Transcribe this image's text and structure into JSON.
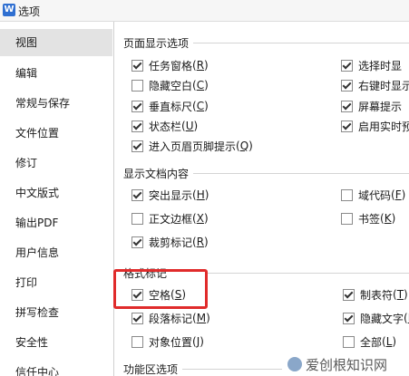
{
  "window": {
    "app_icon": "W",
    "title": "选项"
  },
  "sidebar": {
    "items": [
      {
        "label": "视图",
        "selected": true
      },
      {
        "label": "编辑"
      },
      {
        "label": "常规与保存"
      },
      {
        "label": "文件位置"
      },
      {
        "label": "修订"
      },
      {
        "label": "中文版式"
      },
      {
        "label": "输出PDF"
      },
      {
        "label": "用户信息"
      },
      {
        "label": "打印"
      },
      {
        "label": "拼写检查"
      },
      {
        "label": "安全性"
      },
      {
        "label": "信任中心"
      }
    ]
  },
  "sections": {
    "page_display": {
      "title": "页面显示选项",
      "options": [
        {
          "label": "任务窗格",
          "key": "R",
          "checked": true
        },
        {
          "label": "隐藏空白",
          "key": "C",
          "checked": false
        },
        {
          "label": "垂直标尺",
          "key": "C",
          "checked": true
        },
        {
          "label": "状态栏",
          "key": "U",
          "checked": true
        },
        {
          "label": "进入页眉页脚提示",
          "key": "Q",
          "checked": true
        },
        {
          "label": "选择时显",
          "key": "",
          "checked": true
        },
        {
          "label": "右键时显示",
          "key": "",
          "checked": true
        },
        {
          "label": "屏幕提示",
          "key": "",
          "checked": true
        },
        {
          "label": "启用实时预",
          "key": "",
          "checked": true
        }
      ]
    },
    "doc_content": {
      "title": "显示文档内容",
      "options": [
        {
          "label": "突出显示",
          "key": "H",
          "checked": true
        },
        {
          "label": "正文边框",
          "key": "X",
          "checked": false
        },
        {
          "label": "裁剪标记",
          "key": "R",
          "checked": true
        },
        {
          "label": "域代码",
          "key": "F",
          "checked": false
        },
        {
          "label": "书签",
          "key": "K",
          "checked": false
        }
      ]
    },
    "format_marks": {
      "title": "格式标记",
      "options": [
        {
          "label": "空格",
          "key": "S",
          "checked": true
        },
        {
          "label": "段落标记",
          "key": "M",
          "checked": true
        },
        {
          "label": "对象位置",
          "key": "J",
          "checked": false
        },
        {
          "label": "制表符",
          "key": "T",
          "checked": true
        },
        {
          "label": "隐藏文字",
          "key": "D",
          "checked": true
        },
        {
          "label": "全部",
          "key": "L",
          "checked": false
        }
      ]
    },
    "ribbon": {
      "title": "功能区选项"
    }
  },
  "watermark": {
    "text": "爱创根知识网"
  },
  "colors": {
    "highlight_box": "#e02b2b",
    "selected_nav": "#e3e3e3"
  }
}
